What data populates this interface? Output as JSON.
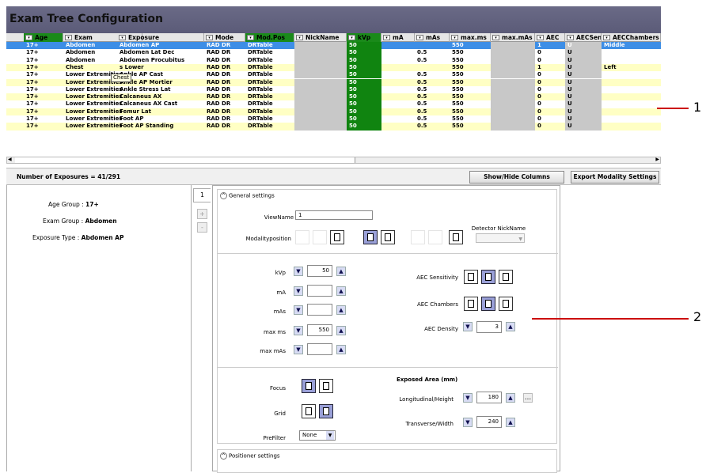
{
  "app": {
    "title": "Exam Tree Configuration"
  },
  "grid": {
    "columns": [
      "Age",
      "Exam",
      "Exposure",
      "Mode",
      "Mod.Pos",
      "NickName",
      "kVp",
      "mA",
      "mAs",
      "max.ms",
      "max.mAs",
      "AEC",
      "AECSen",
      "AECChambers"
    ],
    "rows": [
      [
        "17+",
        "Abdomen",
        "Abdomen AP",
        "RAD DR",
        "DRTable",
        "",
        "50",
        "",
        "",
        "550",
        "",
        "1",
        "U",
        "Middle"
      ],
      [
        "17+",
        "Abdomen",
        "Abdomen Lat Dec",
        "RAD DR",
        "DRTable",
        "",
        "50",
        "",
        "0.5",
        "550",
        "",
        "0",
        "U",
        ""
      ],
      [
        "17+",
        "Abdomen",
        "Abdomen Procubitus",
        "RAD DR",
        "DRTable",
        "",
        "50",
        "",
        "0.5",
        "550",
        "",
        "0",
        "U",
        ""
      ],
      [
        "17+",
        "Chest",
        "s Lower",
        "RAD DR",
        "DRTable",
        "",
        "50",
        "",
        "",
        "550",
        "",
        "1",
        "U",
        "Left"
      ],
      [
        "17+",
        "Lower Extremities",
        "Ankle AP Cast",
        "RAD DR",
        "DRTable",
        "",
        "50",
        "",
        "0.5",
        "550",
        "",
        "0",
        "U",
        ""
      ],
      [
        "17+",
        "Lower Extremities",
        "Ankle AP Mortier",
        "RAD DR",
        "DRTable",
        "",
        "50",
        "",
        "0.5",
        "550",
        "",
        "0",
        "U",
        ""
      ],
      [
        "17+",
        "Lower Extremities",
        "Ankle Stress Lat",
        "RAD DR",
        "DRTable",
        "",
        "50",
        "",
        "0.5",
        "550",
        "",
        "0",
        "U",
        ""
      ],
      [
        "17+",
        "Lower Extremities",
        "Calcaneus AX",
        "RAD DR",
        "DRTable",
        "",
        "50",
        "",
        "0.5",
        "550",
        "",
        "0",
        "U",
        ""
      ],
      [
        "17+",
        "Lower Extremities",
        "Calcaneus AX Cast",
        "RAD DR",
        "DRTable",
        "",
        "50",
        "",
        "0.5",
        "550",
        "",
        "0",
        "U",
        ""
      ],
      [
        "17+",
        "Lower Extremities",
        "Femur Lat",
        "RAD DR",
        "DRTable",
        "",
        "50",
        "",
        "0.5",
        "550",
        "",
        "0",
        "U",
        ""
      ],
      [
        "17+",
        "Lower Extremities",
        "Foot AP",
        "RAD DR",
        "DRTable",
        "",
        "50",
        "",
        "0.5",
        "550",
        "",
        "0",
        "U",
        ""
      ],
      [
        "17+",
        "Lower Extremities",
        "Foot AP Standing",
        "RAD DR",
        "DRTable",
        "",
        "50",
        "",
        "0.5",
        "550",
        "",
        "0",
        "U",
        ""
      ]
    ],
    "tooltip": "Chest"
  },
  "summary": {
    "label": "Number of Exposures = 41/291",
    "show_hide": "Show/Hide Columns",
    "export": "Export Modality Settings"
  },
  "details": {
    "age_label": "Age Group :",
    "age_value": "17+",
    "exam_label": "Exam Group :",
    "exam_value": "Abdomen",
    "exposure_label": "Exposure Type :",
    "exposure_value": "Abdomen AP"
  },
  "tabs": {
    "tab1": "1",
    "plus": "+",
    "minus": "-"
  },
  "general": {
    "title": "General settings",
    "viewname_label": "ViewName",
    "viewname_value": "1",
    "modality_label": "Modalityposition",
    "detector_label": "Detector NickName",
    "kvp_label": "kVp",
    "kvp_value": "50",
    "ma_label": "mA",
    "ma_value": "",
    "mas_label": "mAs",
    "mas_value": "",
    "maxms_label": "max ms",
    "maxms_value": "550",
    "maxmas_label": "max mAs",
    "maxmas_value": "",
    "aec_sens_label": "AEC Sensitivity",
    "aec_ch_label": "AEC Chambers",
    "aec_den_label": "AEC Density",
    "aec_den_value": "3",
    "focus_label": "Focus",
    "grid_label": "Grid",
    "prefilter_label": "PreFilter",
    "prefilter_value": "None",
    "exposed_title": "Exposed Area (mm)",
    "long_label": "Longitudinal/Height",
    "long_value": "180",
    "trans_label": "Transverse/Width",
    "trans_value": "240",
    "more": "..."
  },
  "positioner": {
    "title": "Positioner settings"
  },
  "callouts": {
    "one": "1",
    "two": "2"
  },
  "colors": {
    "selected": "#3d8ee6",
    "yellow_row": "#ffffc4",
    "green_col": "#108410",
    "title_bar": "#5e5e7c",
    "callout": "#cc0000"
  }
}
